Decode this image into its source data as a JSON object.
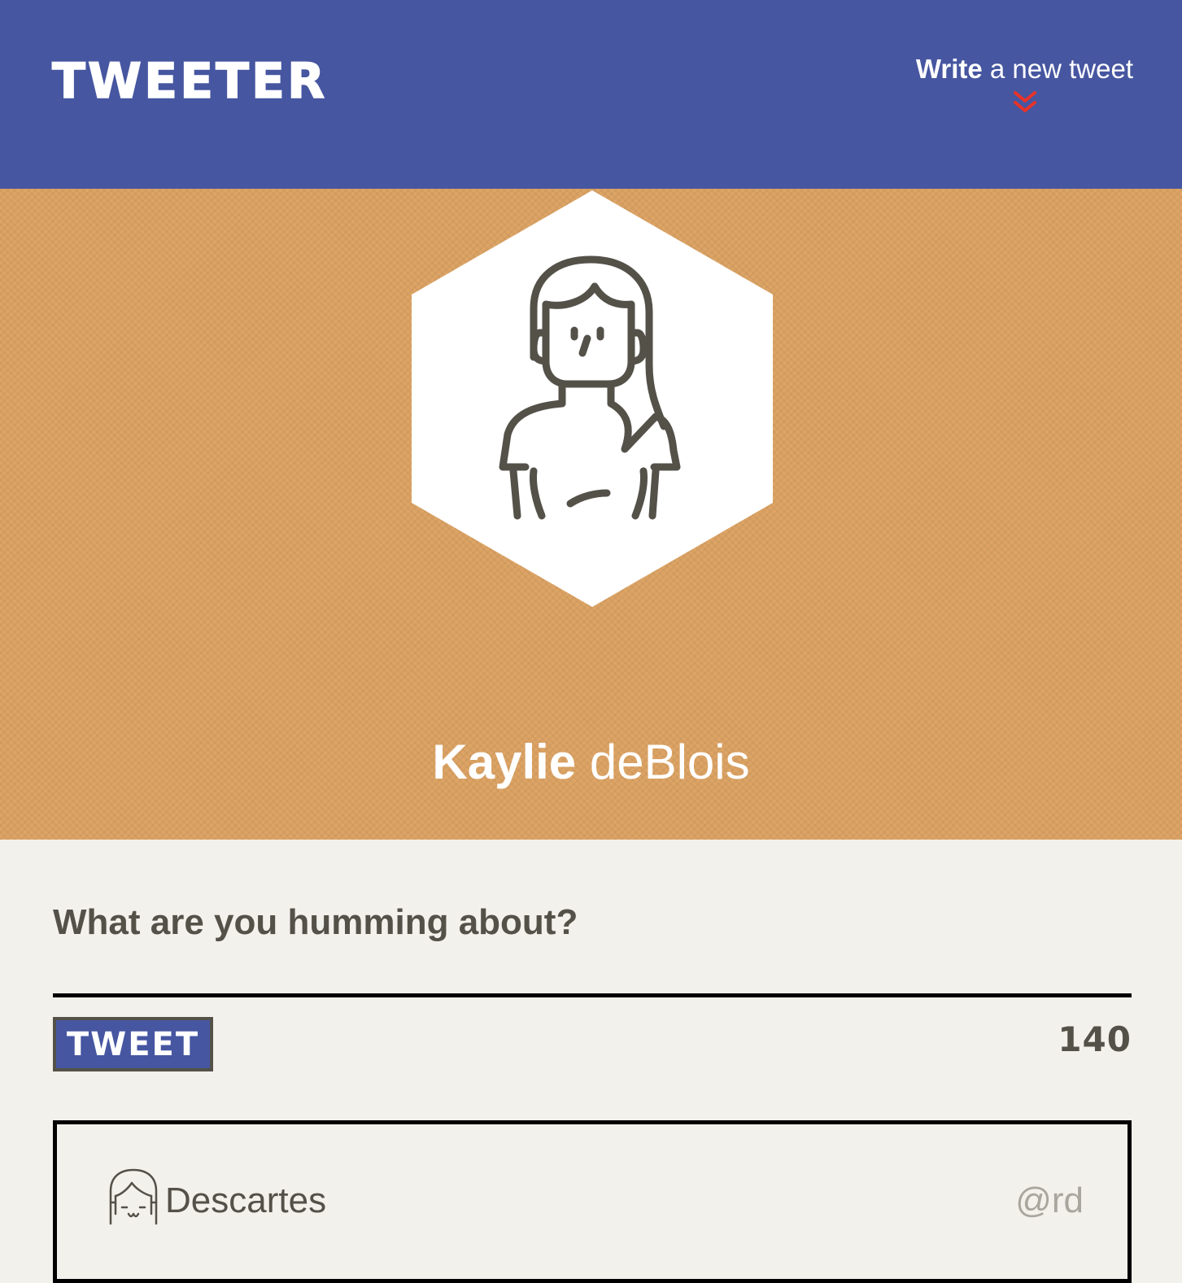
{
  "header": {
    "logo": "TWEETER",
    "compose_toggle": {
      "bold": "Write",
      "light": " a new tweet",
      "icon": "double-chevron-down-icon"
    }
  },
  "profile": {
    "first_name": "Kaylie",
    "last_name": " deBlois",
    "avatar_icon": "woman-avatar-icon"
  },
  "composer": {
    "label": "What are you humming about?",
    "input_value": "",
    "button_label": "TWEET",
    "char_count": "140"
  },
  "tweets": [
    {
      "author": "Descartes",
      "handle": "@rd",
      "avatar_icon": "girl-avatar-icon"
    }
  ],
  "colors": {
    "nav": "#4656a0",
    "profile_bg": "#dda465",
    "page_bg": "#f3f1ec",
    "text": "#545149",
    "accent": "#e8332a"
  }
}
